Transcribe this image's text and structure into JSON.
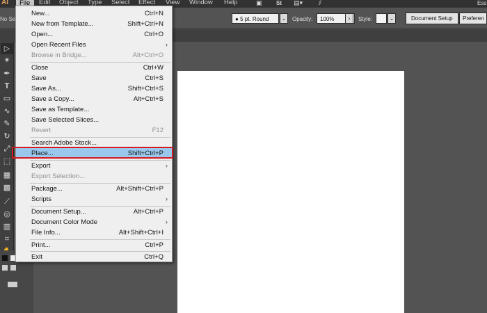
{
  "app": {
    "logo": "AI"
  },
  "menubar": {
    "items": [
      "File",
      "Edit",
      "Object",
      "Type",
      "Select",
      "Effect",
      "View",
      "Window",
      "Help"
    ],
    "stock_icon": "St",
    "right_text": "Ess"
  },
  "control_bar": {
    "selection_text": "No Se",
    "stroke_profile": "5 pt. Round",
    "opacity_label": "Opacity:",
    "opacity_value": "100%",
    "style_label": "Style:",
    "document_setup": "Document Setup",
    "preferences": "Preferen"
  },
  "file_menu": {
    "items": [
      {
        "label": "New...",
        "shortcut": "Ctrl+N",
        "enabled": true
      },
      {
        "label": "New from Template...",
        "shortcut": "Shift+Ctrl+N",
        "enabled": true
      },
      {
        "label": "Open...",
        "shortcut": "Ctrl+O",
        "enabled": true
      },
      {
        "label": "Open Recent Files",
        "shortcut": "",
        "submenu": true,
        "enabled": true
      },
      {
        "label": "Browse in Bridge...",
        "shortcut": "Alt+Ctrl+O",
        "enabled": false
      },
      {
        "label": "Close",
        "shortcut": "Ctrl+W",
        "enabled": true
      },
      {
        "label": "Save",
        "shortcut": "Ctrl+S",
        "enabled": true
      },
      {
        "label": "Save As...",
        "shortcut": "Shift+Ctrl+S",
        "enabled": true
      },
      {
        "label": "Save a Copy...",
        "shortcut": "Alt+Ctrl+S",
        "enabled": true
      },
      {
        "label": "Save as Template...",
        "shortcut": "",
        "enabled": true
      },
      {
        "label": "Save Selected Slices...",
        "shortcut": "",
        "enabled": true
      },
      {
        "label": "Revert",
        "shortcut": "F12",
        "enabled": false
      },
      {
        "label": "Search Adobe Stock...",
        "shortcut": "",
        "enabled": true
      },
      {
        "label": "Place...",
        "shortcut": "Shift+Ctrl+P",
        "enabled": true,
        "highlighted": true
      },
      {
        "label": "Export",
        "shortcut": "",
        "submenu": true,
        "enabled": true
      },
      {
        "label": "Export Selection...",
        "shortcut": "",
        "enabled": false
      },
      {
        "label": "Package...",
        "shortcut": "Alt+Shift+Ctrl+P",
        "enabled": true
      },
      {
        "label": "Scripts",
        "shortcut": "",
        "submenu": true,
        "enabled": true
      },
      {
        "label": "Document Setup...",
        "shortcut": "Alt+Ctrl+P",
        "enabled": true
      },
      {
        "label": "Document Color Mode",
        "shortcut": "",
        "submenu": true,
        "enabled": true
      },
      {
        "label": "File Info...",
        "shortcut": "Alt+Shift+Ctrl+I",
        "enabled": true
      },
      {
        "label": "Print...",
        "shortcut": "Ctrl+P",
        "enabled": true
      },
      {
        "label": "Exit",
        "shortcut": "Ctrl+Q",
        "enabled": true
      }
    ]
  },
  "colors": {
    "highlight": "#99c8ec",
    "highlight_outline": "#d51920",
    "workspace": "#535353",
    "menubar": "#323232"
  }
}
